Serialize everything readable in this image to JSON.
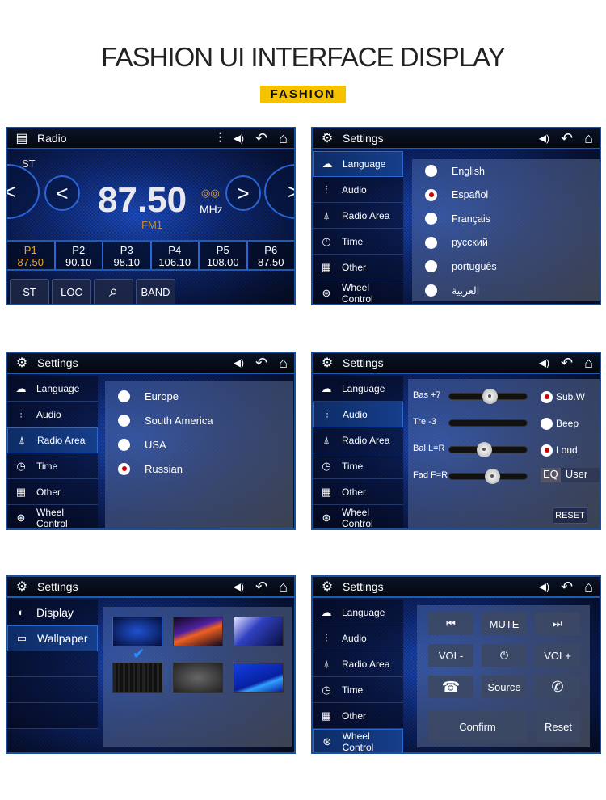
{
  "heading": "FASHION UI INTERFACE DISPLAY",
  "tag": "FASHION",
  "colors": {
    "accent": "#f5c200",
    "frame": "#1b4f9a",
    "preset_active": "#f5a623",
    "radio_on": "#cc0000"
  },
  "header_icons": {
    "settings": "gear-icon",
    "volume": "volume-icon",
    "back": "back-icon",
    "home": "home-icon",
    "radio": "radio-icon",
    "equalizer": "equalizer-icon"
  },
  "radio": {
    "title": "Radio",
    "stereo": "ST",
    "frequency": "87.50",
    "unit": "MHz",
    "band": "FM1",
    "presets": [
      {
        "label": "P1",
        "freq": "87.50",
        "active": true
      },
      {
        "label": "P2",
        "freq": "90.10"
      },
      {
        "label": "P3",
        "freq": "98.10"
      },
      {
        "label": "P4",
        "freq": "106.10"
      },
      {
        "label": "P5",
        "freq": "108.00"
      },
      {
        "label": "P6",
        "freq": "87.50"
      }
    ],
    "buttons": [
      "ST",
      "LOC",
      "search-icon",
      "BAND"
    ]
  },
  "settings_title": "Settings",
  "menu": [
    {
      "label": "Language",
      "icon": "chat-icon"
    },
    {
      "label": "Audio",
      "icon": "equalizer-icon"
    },
    {
      "label": "Radio Area",
      "icon": "antenna-icon"
    },
    {
      "label": "Time",
      "icon": "clock-icon"
    },
    {
      "label": "Other",
      "icon": "grid-icon"
    },
    {
      "label": "Wheel Control",
      "icon": "steering-wheel-icon"
    }
  ],
  "language": {
    "options": [
      "English",
      "Español",
      "Français",
      "русский",
      "português",
      "العربية"
    ],
    "selected": "Español"
  },
  "radio_area": {
    "options": [
      "Europe",
      "South America",
      "USA",
      "Russian"
    ],
    "selected": "Russian"
  },
  "audio": {
    "sliders": [
      {
        "label": "Bas +7",
        "level": 0.52
      },
      {
        "label": "Tre -3",
        "level": null
      },
      {
        "label": "Bal L=R",
        "level": 0.45
      },
      {
        "label": "Fad F=R",
        "level": 0.55
      }
    ],
    "toggles": [
      {
        "label": "Sub.W",
        "on": true
      },
      {
        "label": "Beep",
        "on": false
      },
      {
        "label": "Loud",
        "on": true
      }
    ],
    "eq_label": "EQ",
    "eq_value": "User",
    "reset": "RESET"
  },
  "display_menu": [
    {
      "label": "Display",
      "icon": "contrast-icon"
    },
    {
      "label": "Wallpaper",
      "icon": "image-icon"
    }
  ],
  "wallpaper": {
    "selected_index": 0,
    "count": 6
  },
  "wheel": {
    "buttons": [
      "⏮",
      "MUTE",
      "⏭",
      "VOL-",
      "⏻",
      "VOL+",
      "hang-up-icon",
      "Source",
      "call-icon"
    ],
    "confirm": "Confirm",
    "reset": "Reset"
  }
}
